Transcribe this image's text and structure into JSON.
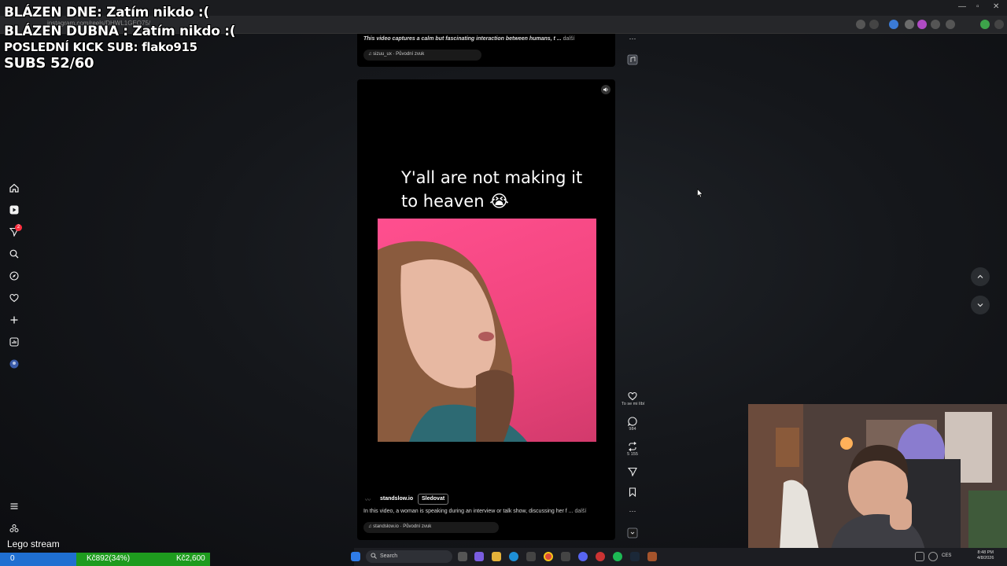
{
  "browser": {
    "url": "instagram.com/reels/DHWL1GEO75/"
  },
  "overlay": {
    "line1": "BLÁZEN DNE: Zatím nikdo :(",
    "line2": "BLÁZEN DUBNA : Zatím nikdo :(",
    "line3": "POSLEDNÍ KICK SUB: flako915",
    "line4": "SUBS 52/60"
  },
  "nav": {
    "notification_count": "2",
    "items": [
      "home-icon",
      "reels-icon",
      "messages-icon",
      "search-icon",
      "explore-icon",
      "heart-icon",
      "create-icon",
      "dashboard-icon",
      "profile-icon"
    ]
  },
  "reel_top": {
    "caption": "This video captures a calm but fascinating interaction between humans, t ...",
    "more": "další",
    "audio": "sizuu_ux · Původní zvuk"
  },
  "reel": {
    "meme_text": "Y'all are not making it to heaven 😭",
    "username": "standslow.io",
    "follow": "Sledovat",
    "caption": "In this video, a woman is speaking during an interview or talk show, discussing her f ...",
    "more": "další",
    "audio": "standslow.io · Původní zvuk"
  },
  "actions": {
    "like_label": "To se mi líbí",
    "comments": "984",
    "reposts": "5 155"
  },
  "stream": {
    "label": "Lego stream",
    "bar_left": "0",
    "bar_mid": "Kč892(34%)",
    "bar_right": "Kč2,600"
  },
  "taskbar": {
    "search_placeholder": "Search",
    "lang": "CES",
    "time": "8:48 PM",
    "date": "4/8/2026"
  },
  "colors": {
    "bar_blue": "#1f6fd1",
    "bar_green": "#1e9b1e",
    "meme_bg": "#f0457d"
  }
}
